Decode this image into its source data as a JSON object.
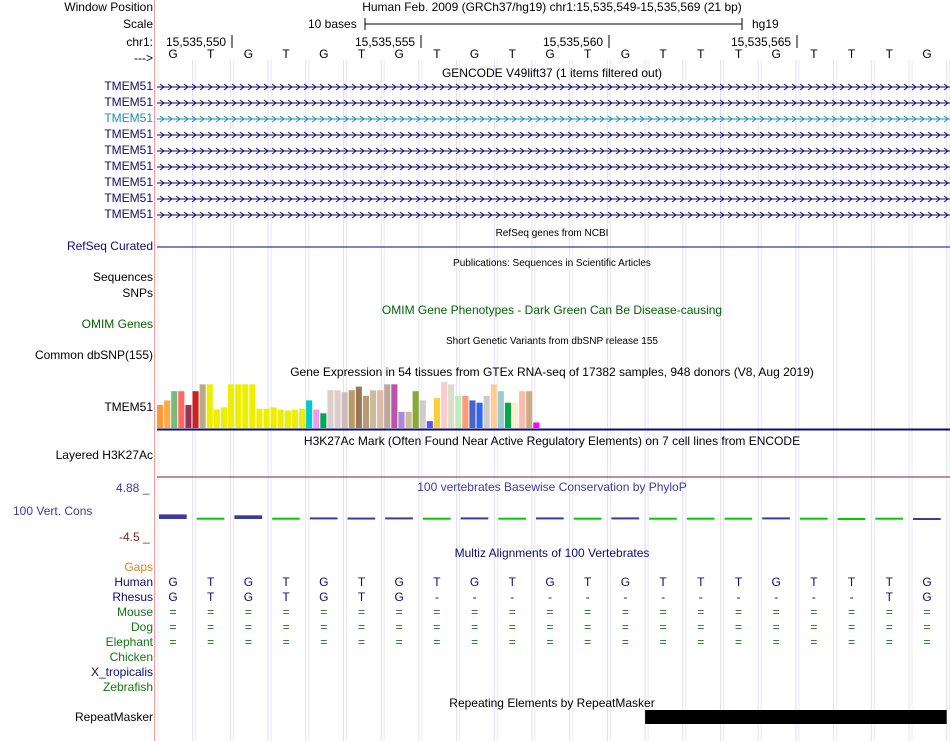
{
  "header": {
    "window_position_label": "Window Position",
    "scale_label": "Scale",
    "chr_label": "chr1:",
    "strand_label": "--->",
    "assembly_position": "Human Feb. 2009 (GRCh37/hg19)   chr1:15,535,549-15,535,569 (21 bp)",
    "scale_text": "10 bases",
    "scale_db": "hg19",
    "coordinates": [
      "15,535,550",
      "15,535,555",
      "15,535,560",
      "15,535,565"
    ],
    "sequence": [
      "G",
      "T",
      "G",
      "T",
      "G",
      "T",
      "G",
      "T",
      "G",
      "T",
      "G",
      "T",
      "G",
      "T",
      "T",
      "T",
      "G",
      "T",
      "T",
      "T",
      "G"
    ]
  },
  "gencode": {
    "title": "GENCODE V49lift37 (1 items filtered out)",
    "transcripts": [
      "TMEM51",
      "TMEM51",
      "TMEM51",
      "TMEM51",
      "TMEM51",
      "TMEM51",
      "TMEM51",
      "TMEM51",
      "TMEM51"
    ],
    "color": "#0c0c78",
    "highlight_color": "#1a8fb8"
  },
  "refseq": {
    "label": "RefSeq Curated",
    "title": "RefSeq genes from NCBI",
    "color": "#0c0c78"
  },
  "publications": {
    "title": "Publications: Sequences in Scientific Articles",
    "labels": [
      "Sequences",
      "SNPs"
    ]
  },
  "omim": {
    "title": "OMIM Gene Phenotypes - Dark Green Can Be Disease-causing",
    "label": "OMIM Genes",
    "color": "#006400"
  },
  "dbsnp": {
    "title": "Short Genetic Variants from dbSNP release 155",
    "label": "Common dbSNP(155)"
  },
  "gtex": {
    "title": "Gene Expression in 54 tissues from GTEx RNA-seq of 17382 samples, 948 donors (V8, Aug 2019)",
    "label": "TMEM51",
    "tissue_levels": [
      0.5,
      0.6,
      0.8,
      0.8,
      0.5,
      0.8,
      0.95,
      0.95,
      0.4,
      0.45,
      0.95,
      0.95,
      0.95,
      0.95,
      0.42,
      0.42,
      0.45,
      0.4,
      0.38,
      0.4,
      0.42,
      0.6,
      0.4,
      0.32,
      0.82,
      0.82,
      0.78,
      0.82,
      0.9,
      0.7,
      0.82,
      0.82,
      0.95,
      0.95,
      0.35,
      0.35,
      0.8,
      0.6,
      0.15,
      0.65,
      1.0,
      0.95,
      0.7,
      0.7,
      0.6,
      0.55,
      0.7,
      0.95,
      0.8,
      0.55,
      0.55,
      0.8,
      0.8,
      0.12
    ],
    "tissue_colors": [
      "#ff9933",
      "#ffaa44",
      "#77bb77",
      "#ff6666",
      "#993355",
      "#cc2222",
      "#bbaa88",
      "#eeee00",
      "#eeee00",
      "#eeee00",
      "#eeee00",
      "#eeee00",
      "#eeee00",
      "#eeee00",
      "#eeee00",
      "#eeee00",
      "#eeee00",
      "#eeee00",
      "#eeee00",
      "#eeee00",
      "#eeee00",
      "#00cccc",
      "#ee99ee",
      "#00aa55",
      "#ddcccc",
      "#ddcccc",
      "#ccbbbb",
      "#bb9966",
      "#997755",
      "#bb9977",
      "#ccbb99",
      "#ddbbaa",
      "#bbaa99",
      "#bb55aa",
      "#aa88dd",
      "#ccbb99",
      "#88aa33",
      "#cccccc",
      "#5555ff",
      "#ffcc33",
      "#ffcccc",
      "#ddddcc",
      "#bbeebb",
      "#ff9977",
      "#4466cc",
      "#3366ee",
      "#cccccc",
      "#ffcc99",
      "#99cccc",
      "#00aa44",
      "#ffeecc",
      "#ffbbaa",
      "#ccaa88",
      "#ff00ff"
    ]
  },
  "h3k27ac": {
    "title": "H3K27Ac Mark (Often Found Near Active Regulatory Elements) on 7 cell lines from ENCODE",
    "label": "Layered H3K27Ac",
    "color": "#8b1a4a"
  },
  "conservation": {
    "title": "100 vertebrates Basewise Conservation by PhyloP",
    "label": "100 Vert. Cons",
    "ymax": "4.88 _",
    "ymin": "-4.5 _",
    "color": "#3b3b9b",
    "scores": [
      1.2,
      0.1,
      0.9,
      0.1,
      0.2,
      0.15,
      0.2,
      0.1,
      0.2,
      0.1,
      0.2,
      0.1,
      0.2,
      0.1,
      0.1,
      0.1,
      0.2,
      0.1,
      -0.1,
      0.1,
      -0.2
    ],
    "score_colors": [
      "#3b3b9b",
      "#00cc00",
      "#3b3b9b",
      "#00cc00",
      "#3b3b9b",
      "#3b3b9b",
      "#3b3b9b",
      "#00cc00",
      "#3b3b9b",
      "#00cc00",
      "#3b3b9b",
      "#00cc00",
      "#3b3b9b",
      "#00cc00",
      "#00cc00",
      "#00cc00",
      "#3b3b9b",
      "#00cc00",
      "#00cc00",
      "#00cc00",
      "#3b3b9b"
    ]
  },
  "multiz": {
    "title": "Multiz Alignments of 100 Vertebrates",
    "gaps_label": "Gaps",
    "gaps_color": "#d48a1a",
    "species": [
      {
        "name": "Human",
        "color": "#0c0c78",
        "bases": [
          "G",
          "T",
          "G",
          "T",
          "G",
          "T",
          "G",
          "T",
          "G",
          "T",
          "G",
          "T",
          "G",
          "T",
          "T",
          "T",
          "G",
          "T",
          "T",
          "T",
          "G"
        ]
      },
      {
        "name": "Rhesus",
        "color": "#0c0c78",
        "bases": [
          "G",
          "T",
          "G",
          "T",
          "G",
          "T",
          "G",
          "-",
          "-",
          "-",
          "-",
          "-",
          "-",
          "-",
          "-",
          "-",
          "-",
          "-",
          "-",
          "T",
          "G"
        ]
      },
      {
        "name": "Mouse",
        "color": "#117711",
        "bases": [
          "=",
          "=",
          "=",
          "=",
          "=",
          "=",
          "=",
          "=",
          "=",
          "=",
          "=",
          "=",
          "=",
          "=",
          "=",
          "=",
          "=",
          "=",
          "=",
          "=",
          "="
        ]
      },
      {
        "name": "Dog",
        "color": "#117711",
        "bases": [
          "=",
          "=",
          "=",
          "=",
          "=",
          "=",
          "=",
          "=",
          "=",
          "=",
          "=",
          "=",
          "=",
          "=",
          "=",
          "=",
          "=",
          "=",
          "=",
          "=",
          "="
        ]
      },
      {
        "name": "Elephant",
        "color": "#117711",
        "bases": [
          "=",
          "=",
          "=",
          "=",
          "=",
          "=",
          "=",
          "=",
          "=",
          "=",
          "=",
          "=",
          "=",
          "=",
          "=",
          "=",
          "=",
          "=",
          "=",
          "=",
          "="
        ]
      },
      {
        "name": "Chicken",
        "color": "#117711",
        "bases": []
      },
      {
        "name": "X_tropicalis",
        "color": "#0c0c78",
        "bases": []
      },
      {
        "name": "Zebrafish",
        "color": "#117711",
        "bases": []
      }
    ]
  },
  "repeatmasker": {
    "title": "Repeating Elements by RepeatMasker",
    "label": "RepeatMasker",
    "block_start_base": 13,
    "block_end_base": 21
  }
}
